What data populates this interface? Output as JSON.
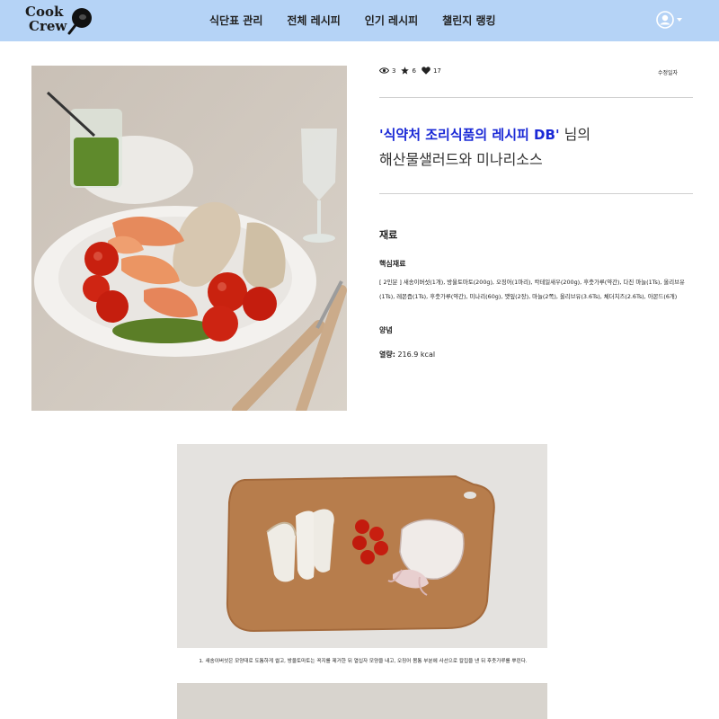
{
  "nav": {
    "logo_line1": "Cook",
    "logo_line2": "Crew",
    "items": [
      {
        "label": "식단표 관리"
      },
      {
        "label": "전체 레시피"
      },
      {
        "label": "인기 레시피"
      },
      {
        "label": "챌린지 랭킹"
      }
    ]
  },
  "stats": {
    "views": "3",
    "stars": "6",
    "likes": "17",
    "edit_label": "수정일자"
  },
  "recipe": {
    "author": "'식약처 조리식품의 레시피 DB'",
    "author_suffix": " 님의",
    "title": "해산물샐러드와 미나리소스"
  },
  "ingredients": {
    "heading": "재료",
    "core_label": "핵심재료",
    "core_text": "[ 2인분 ] 새송이버섯(1개), 방울토마토(200g), 오징어(1마리), 칵테일새우(200g), 후춧가루(약간), 다진 마늘(1Ts), 올리브유(1Ts), 레몬즙(1Ts), 후춧가루(약간), 미나리(60g), 깻잎(2장), 마늘(2쪽), 올리브유(3.6Ts), 체더치즈(2.6Ts), 아몬드(6개)",
    "sauce_label": "양념",
    "calorie_label": "열량:",
    "calorie_value": " 216.9 kcal"
  },
  "steps": [
    {
      "text": "1. 새송이버섯은 모양대로 도톰하게 썰고, 방울토마토는 꼭지를 제거한 뒤 열십자 모양을 내고, 오징어 몸통 부분에 사선으로 칼집을 낸 뒤 후춧가루를 뿌린다."
    }
  ],
  "colors": {
    "navbar": "#b5d3f6",
    "author": "#1a29d6"
  }
}
